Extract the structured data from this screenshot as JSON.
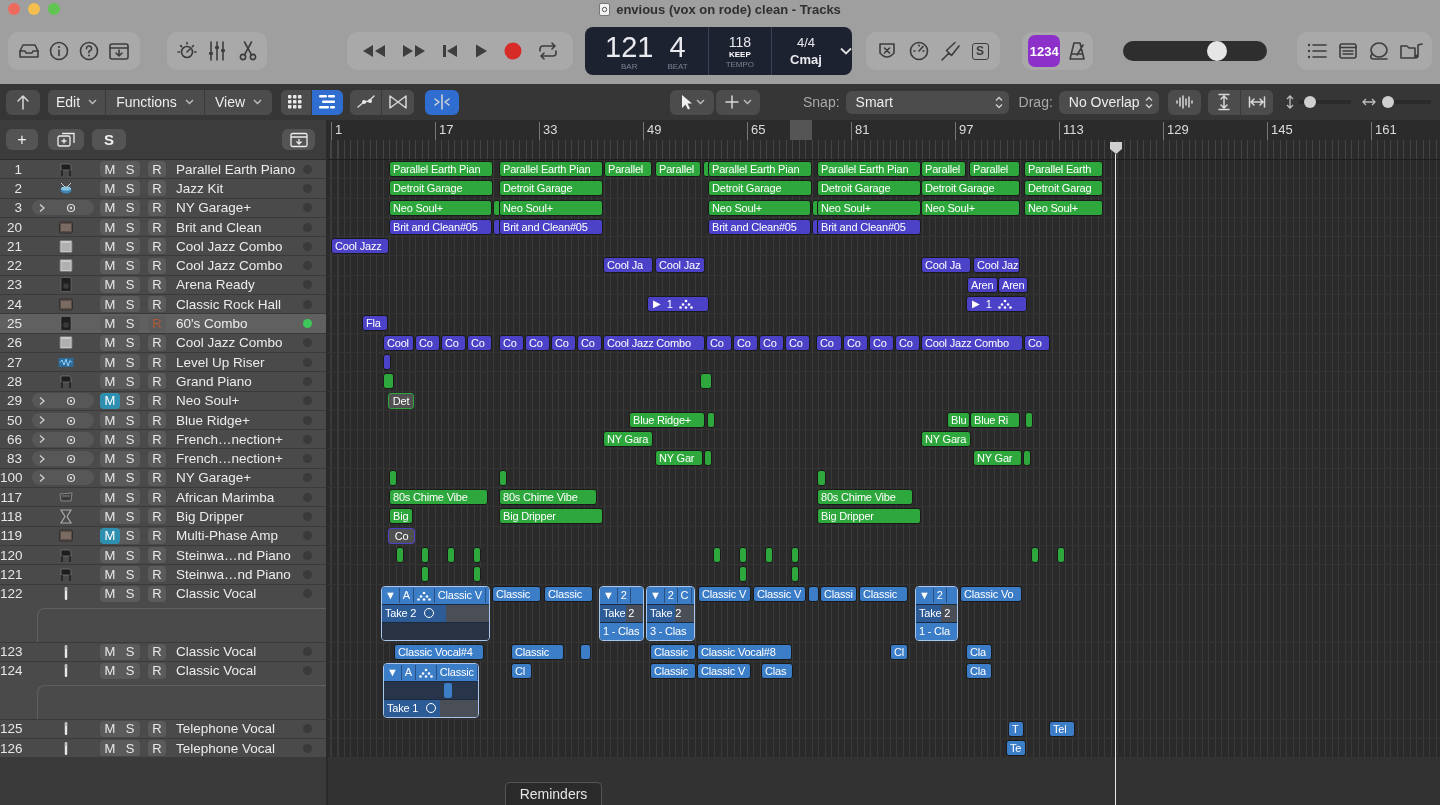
{
  "window": {
    "title": "envious (vox on rode) clean - Tracks"
  },
  "toolbar": {
    "letter_button": "S",
    "count_in": {
      "label": "1234",
      "on": true
    },
    "master_volume": {
      "level": 0.68
    }
  },
  "lcd": {
    "bar": "121",
    "bar_label": "BAR",
    "beat": "4",
    "beat_label": "BEAT",
    "tempo": "118",
    "tempo_mode": "KEEP",
    "tempo_label": "TEMPO",
    "signature": "4/4",
    "key": "Cmaj"
  },
  "control_bar": {
    "menus": [
      "Edit",
      "Functions",
      "View"
    ],
    "view_buttons": [
      {
        "kind": "grid",
        "selected": false
      },
      {
        "kind": "list",
        "selected": true
      }
    ],
    "mode_buttons": [
      {
        "kind": "automation",
        "selected": false
      },
      {
        "kind": "flex",
        "selected": false
      },
      {
        "kind": "catch",
        "selected": true
      }
    ],
    "snap": {
      "label": "Snap:",
      "value": "Smart"
    },
    "drag": {
      "label": "Drag:",
      "value": "No Overlap"
    },
    "zoom_sliders": [
      {
        "kind": "vertical",
        "level": 0.13
      },
      {
        "kind": "horizontal",
        "level": 0.03
      }
    ]
  },
  "track_header": {
    "add": "+",
    "solo_mode": "S"
  },
  "ruler": [
    "1",
    "17",
    "33",
    "49",
    "65",
    "81",
    "97",
    "113",
    "129",
    "145",
    "161"
  ],
  "tracks": [
    {
      "number": "1",
      "name": "Parallel Earth Piano",
      "kind": "piano",
      "stack": false,
      "takes_open": false,
      "muted": false,
      "selected": false,
      "buttons": [
        "M",
        "S",
        "R"
      ],
      "regions": [
        {
          "kind": "region",
          "label": "Parallel Earth Pian",
          "color": "#2ea83c"
        },
        {
          "kind": "region",
          "label": "Parallel Earth Pian",
          "color": "#2ea83c"
        },
        {
          "kind": "region",
          "label": "Parallel",
          "color": "#2ea83c"
        },
        {
          "kind": "region",
          "label": "Parallel",
          "color": "#2ea83c"
        },
        {
          "kind": "region",
          "color": "#2ea83c"
        },
        {
          "kind": "region",
          "label": "Parallel Earth Pian",
          "color": "#2ea83c"
        },
        {
          "kind": "region",
          "label": "Parallel Earth Pian",
          "color": "#2ea83c"
        },
        {
          "kind": "region",
          "label": "Parallel",
          "color": "#2ea83c"
        },
        {
          "kind": "region",
          "label": "Parallel",
          "color": "#2ea83c"
        },
        {
          "kind": "region",
          "label": "Parallel Earth",
          "color": "#2ea83c"
        }
      ]
    },
    {
      "number": "2",
      "name": "Jazz Kit",
      "kind": "drums",
      "stack": false,
      "takes_open": false,
      "muted": false,
      "selected": false,
      "buttons": [
        "M",
        "S",
        "R"
      ],
      "regions": [
        {
          "kind": "region",
          "label": "Detroit Garage",
          "color": "#2ea83c"
        },
        {
          "kind": "region",
          "label": "Detroit Garage",
          "color": "#2ea83c"
        },
        {
          "kind": "region",
          "label": "Detroit Garage",
          "color": "#2ea83c"
        },
        {
          "kind": "region",
          "label": "Detroit Garage",
          "color": "#2ea83c"
        },
        {
          "kind": "region",
          "label": "Detroit Garage",
          "color": "#2ea83c"
        },
        {
          "kind": "region",
          "label": "Detroit Garag",
          "color": "#2ea83c"
        }
      ]
    },
    {
      "number": "3",
      "name": "NY Garage+",
      "kind": "patch",
      "stack": true,
      "takes_open": false,
      "muted": false,
      "selected": false,
      "buttons": [
        "M",
        "S",
        "R"
      ],
      "regions": [
        {
          "kind": "region",
          "label": "Neo Soul+",
          "color": "#2ea83c"
        },
        {
          "kind": "region",
          "color": "#2ea83c"
        },
        {
          "kind": "region",
          "label": "Neo Soul+",
          "color": "#2ea83c"
        },
        {
          "kind": "region",
          "label": "Neo Soul+",
          "color": "#2ea83c"
        },
        {
          "kind": "region",
          "color": "#2ea83c"
        },
        {
          "kind": "region",
          "label": "Neo Soul+",
          "color": "#2ea83c"
        },
        {
          "kind": "region",
          "label": "Neo Soul+",
          "color": "#2ea83c"
        },
        {
          "kind": "region",
          "label": "Neo Soul+",
          "color": "#2ea83c"
        }
      ]
    },
    {
      "number": "20",
      "name": "Brit and Clean",
      "kind": "amp",
      "stack": false,
      "takes_open": false,
      "muted": false,
      "selected": false,
      "buttons": [
        "M",
        "S",
        "R"
      ],
      "regions": [
        {
          "kind": "region",
          "label": "Brit and Clean#05",
          "color": "#4c42c8"
        },
        {
          "kind": "region",
          "color": "#4c42c8"
        },
        {
          "kind": "region",
          "label": "Brit and Clean#05",
          "color": "#4c42c8"
        },
        {
          "kind": "region",
          "label": "Brit and Clean#05",
          "color": "#4c42c8"
        },
        {
          "kind": "region",
          "color": "#4c42c8"
        },
        {
          "kind": "region",
          "label": "Brit and Clean#05",
          "color": "#4c42c8"
        }
      ]
    },
    {
      "number": "21",
      "name": "Cool Jazz Combo",
      "kind": "cabinet",
      "stack": false,
      "takes_open": false,
      "muted": false,
      "selected": false,
      "buttons": [
        "M",
        "S",
        "R"
      ],
      "regions": [
        {
          "kind": "region",
          "label": "Cool Jazz",
          "color": "#4c42c8"
        }
      ]
    },
    {
      "number": "22",
      "name": "Cool Jazz Combo",
      "kind": "cabinet",
      "stack": false,
      "takes_open": false,
      "muted": false,
      "selected": false,
      "buttons": [
        "M",
        "S",
        "R"
      ],
      "regions": [
        {
          "kind": "region",
          "label": "Cool Ja",
          "color": "#4c42c8"
        },
        {
          "kind": "region",
          "label": "Cool Jaz",
          "color": "#4c42c8"
        },
        {
          "kind": "region",
          "label": "Cool Ja",
          "color": "#4c42c8"
        },
        {
          "kind": "region",
          "label": "Cool Jaz",
          "color": "#4c42c8"
        }
      ]
    },
    {
      "number": "23",
      "name": "Arena Ready",
      "kind": "tower",
      "stack": false,
      "takes_open": false,
      "muted": false,
      "selected": false,
      "buttons": [
        "M",
        "S",
        "R"
      ],
      "regions": [
        {
          "kind": "region",
          "label": "Aren",
          "color": "#4c42c8"
        },
        {
          "kind": "region",
          "label": "Aren",
          "color": "#4c42c8"
        }
      ]
    },
    {
      "number": "24",
      "name": "Classic Rock Hall",
      "kind": "amp",
      "stack": false,
      "takes_open": false,
      "muted": false,
      "selected": false,
      "buttons": [
        "M",
        "S",
        "R"
      ],
      "regions": [
        {
          "kind": "pattern",
          "play": "▶",
          "label": "1",
          "color": "#4c42c8"
        },
        {
          "kind": "pattern",
          "play": "▶",
          "label": "1",
          "color": "#4c42c8"
        }
      ]
    },
    {
      "number": "25",
      "name": "60's Combo",
      "kind": "tower",
      "stack": false,
      "takes_open": false,
      "muted": false,
      "selected": true,
      "buttons": [
        "M",
        "S",
        "R"
      ],
      "regions": [
        {
          "kind": "region",
          "label": "Fla",
          "color": "#4c42c8"
        }
      ]
    },
    {
      "number": "26",
      "name": "Cool Jazz Combo",
      "kind": "cabinet",
      "stack": false,
      "takes_open": false,
      "muted": false,
      "selected": false,
      "buttons": [
        "M",
        "S",
        "R"
      ],
      "regions": [
        {
          "kind": "region",
          "label": "Cool",
          "color": "#4c42c8"
        },
        {
          "kind": "region",
          "label": "Co",
          "color": "#4c42c8"
        },
        {
          "kind": "region",
          "label": "Co",
          "color": "#4c42c8"
        },
        {
          "kind": "region",
          "label": "Co",
          "color": "#4c42c8"
        },
        {
          "kind": "region",
          "label": "Co",
          "color": "#4c42c8"
        },
        {
          "kind": "region",
          "label": "Co",
          "color": "#4c42c8"
        },
        {
          "kind": "region",
          "label": "Co",
          "color": "#4c42c8"
        },
        {
          "kind": "region",
          "label": "Co",
          "color": "#4c42c8"
        },
        {
          "kind": "region",
          "label": "Cool Jazz Combo",
          "color": "#4c42c8"
        },
        {
          "kind": "region",
          "label": "Co",
          "color": "#4c42c8"
        },
        {
          "kind": "region",
          "label": "Co",
          "color": "#4c42c8"
        },
        {
          "kind": "region",
          "label": "Co",
          "color": "#4c42c8"
        },
        {
          "kind": "region",
          "label": "Co",
          "color": "#4c42c8"
        },
        {
          "kind": "region",
          "label": "Co",
          "color": "#4c42c8"
        },
        {
          "kind": "region",
          "label": "Co",
          "color": "#4c42c8"
        },
        {
          "kind": "region",
          "label": "Co",
          "color": "#4c42c8"
        },
        {
          "kind": "region",
          "label": "Co",
          "color": "#4c42c8"
        },
        {
          "kind": "region",
          "label": "Cool Jazz Combo",
          "color": "#4c42c8"
        },
        {
          "kind": "region",
          "label": "Co",
          "color": "#4c42c8"
        }
      ]
    },
    {
      "number": "27",
      "name": "Level Up Riser",
      "kind": "riser",
      "stack": false,
      "takes_open": false,
      "muted": false,
      "selected": false,
      "buttons": [
        "M",
        "S",
        "R"
      ],
      "regions": [
        {
          "kind": "region",
          "color": "#4c42c8"
        }
      ]
    },
    {
      "number": "28",
      "name": "Grand Piano",
      "kind": "piano",
      "stack": false,
      "takes_open": false,
      "muted": false,
      "selected": false,
      "buttons": [
        "M",
        "S",
        "R"
      ],
      "regions": [
        {
          "kind": "region",
          "color": "#2ea83c"
        },
        {
          "kind": "region",
          "color": "#2ea83c"
        }
      ]
    },
    {
      "number": "29",
      "name": "Neo Soul+",
      "kind": "patch",
      "stack": true,
      "takes_open": false,
      "muted": true,
      "selected": false,
      "buttons": [
        "M",
        "S",
        "R"
      ],
      "regions": [
        {
          "kind": "region",
          "label": "Det",
          "color": "#2ea83c"
        }
      ]
    },
    {
      "number": "50",
      "name": "Blue Ridge+",
      "kind": "patch",
      "stack": true,
      "takes_open": false,
      "muted": false,
      "selected": false,
      "buttons": [
        "M",
        "S",
        "R"
      ],
      "regions": [
        {
          "kind": "region",
          "label": "Blue Ridge+",
          "color": "#2ea83c"
        },
        {
          "kind": "region",
          "color": "#2ea83c"
        },
        {
          "kind": "region",
          "label": "Blu",
          "color": "#2ea83c"
        },
        {
          "kind": "region",
          "label": "Blue Ri",
          "color": "#2ea83c"
        },
        {
          "kind": "region",
          "color": "#2ea83c"
        }
      ]
    },
    {
      "number": "66",
      "name": "French…nection+",
      "kind": "patch",
      "stack": true,
      "takes_open": false,
      "muted": false,
      "selected": false,
      "buttons": [
        "M",
        "S",
        "R"
      ],
      "regions": [
        {
          "kind": "region",
          "label": "NY Gara",
          "color": "#2ea83c"
        },
        {
          "kind": "region",
          "label": "NY Gara",
          "color": "#2ea83c"
        }
      ]
    },
    {
      "number": "83",
      "name": "French…nection+",
      "kind": "patch",
      "stack": true,
      "takes_open": false,
      "muted": false,
      "selected": false,
      "buttons": [
        "M",
        "S",
        "R"
      ],
      "regions": [
        {
          "kind": "region",
          "label": "NY Gar",
          "color": "#2ea83c"
        },
        {
          "kind": "region",
          "color": "#2ea83c"
        },
        {
          "kind": "region",
          "label": "NY Gar",
          "color": "#2ea83c"
        },
        {
          "kind": "region",
          "color": "#2ea83c"
        }
      ]
    },
    {
      "number": "100",
      "name": "NY Garage+",
      "kind": "patch",
      "stack": true,
      "takes_open": false,
      "muted": false,
      "selected": false,
      "buttons": [
        "M",
        "S",
        "R"
      ],
      "regions": [
        {
          "kind": "region",
          "color": "#2ea83c"
        },
        {
          "kind": "region",
          "color": "#2ea83c"
        },
        {
          "kind": "region",
          "color": "#2ea83c"
        }
      ]
    },
    {
      "number": "117",
      "name": "African Marimba",
      "kind": "marimba",
      "stack": false,
      "takes_open": false,
      "muted": false,
      "selected": false,
      "buttons": [
        "M",
        "S",
        "R"
      ],
      "regions": [
        {
          "kind": "region",
          "label": "80s Chime Vibe",
          "color": "#2ea83c"
        },
        {
          "kind": "region",
          "label": "80s Chime Vibe",
          "color": "#2ea83c"
        },
        {
          "kind": "region",
          "label": "80s Chime Vibe",
          "color": "#2ea83c"
        }
      ]
    },
    {
      "number": "118",
      "name": "Big Dripper",
      "kind": "dripper",
      "stack": false,
      "takes_open": false,
      "muted": false,
      "selected": false,
      "buttons": [
        "M",
        "S",
        "R"
      ],
      "regions": [
        {
          "kind": "region",
          "label": "Big",
          "color": "#2ea83c"
        },
        {
          "kind": "region",
          "label": "Big Dripper",
          "color": "#2ea83c"
        },
        {
          "kind": "region",
          "label": "Big Dripper",
          "color": "#2ea83c"
        }
      ]
    },
    {
      "number": "119",
      "name": "Multi-Phase Amp",
      "kind": "amp",
      "stack": false,
      "takes_open": false,
      "muted": true,
      "selected": false,
      "buttons": [
        "M",
        "S",
        "R"
      ],
      "regions": [
        {
          "kind": "region",
          "label": "Co",
          "color": "#4c42c8"
        }
      ]
    },
    {
      "number": "120",
      "name": "Steinwa…nd Piano",
      "kind": "piano",
      "stack": false,
      "takes_open": false,
      "muted": false,
      "selected": false,
      "buttons": [
        "M",
        "S",
        "R"
      ],
      "regions": [
        {
          "kind": "region",
          "color": "#2ea83c"
        },
        {
          "kind": "region",
          "color": "#2ea83c"
        },
        {
          "kind": "region",
          "color": "#2ea83c"
        },
        {
          "kind": "region",
          "color": "#2ea83c"
        },
        {
          "kind": "region",
          "color": "#2ea83c"
        },
        {
          "kind": "region",
          "color": "#2ea83c"
        },
        {
          "kind": "region",
          "color": "#2ea83c"
        },
        {
          "kind": "region",
          "color": "#2ea83c"
        },
        {
          "kind": "region",
          "color": "#2ea83c"
        },
        {
          "kind": "region",
          "color": "#2ea83c"
        }
      ]
    },
    {
      "number": "121",
      "name": "Steinwa…nd Piano",
      "kind": "piano",
      "stack": false,
      "takes_open": false,
      "muted": false,
      "selected": false,
      "buttons": [
        "M",
        "S",
        "R"
      ],
      "regions": [
        {
          "kind": "region",
          "color": "#2ea83c"
        },
        {
          "kind": "region",
          "color": "#2ea83c"
        },
        {
          "kind": "region",
          "color": "#2ea83c"
        },
        {
          "kind": "region",
          "color": "#2ea83c"
        }
      ]
    },
    {
      "number": "122",
      "name": "Classic Vocal",
      "kind": "mic",
      "stack": false,
      "takes_open": true,
      "muted": false,
      "selected": false,
      "buttons": [
        "M",
        "S",
        "R"
      ],
      "regions": [
        {
          "kind": "take_folder",
          "color": "#3c7dc8",
          "header": [
            {
              "kind": "text",
              "text": "▼"
            },
            {
              "kind": "text",
              "text": "A"
            },
            {
              "kind": "icon"
            },
            {
              "kind": "text",
              "text": "Classic V"
            }
          ],
          "lanes": [
            {
              "kind": "take",
              "label": "Take 2",
              "circle": true
            },
            {
              "kind": "blank"
            }
          ]
        },
        {
          "kind": "region",
          "label": "Classic",
          "color": "#3c7dc8"
        },
        {
          "kind": "region",
          "label": "Classic",
          "color": "#3c7dc8"
        },
        {
          "kind": "take_folder",
          "color": "#3c7dc8",
          "header": [
            {
              "kind": "text",
              "text": "▼"
            },
            {
              "kind": "text",
              "text": "2"
            }
          ],
          "lanes": [
            {
              "kind": "take",
              "label": "Take 2",
              "circle": false
            },
            {
              "kind": "comp",
              "label": "1 - Clas"
            }
          ]
        },
        {
          "kind": "take_folder",
          "color": "#3c7dc8",
          "header": [
            {
              "kind": "text",
              "text": "▼"
            },
            {
              "kind": "text",
              "text": "2"
            },
            {
              "kind": "text",
              "text": "C"
            }
          ],
          "lanes": [
            {
              "kind": "take",
              "label": "Take 2",
              "circle": false
            },
            {
              "kind": "comp",
              "label": "3 - Clas"
            }
          ]
        },
        {
          "kind": "region",
          "label": "Classic V",
          "color": "#3c7dc8"
        },
        {
          "kind": "region",
          "label": "Classic V",
          "color": "#3c7dc8"
        },
        {
          "kind": "region",
          "color": "#3c7dc8"
        },
        {
          "kind": "region",
          "label": "Classi",
          "color": "#3c7dc8"
        },
        {
          "kind": "region",
          "label": "Classic",
          "color": "#3c7dc8"
        },
        {
          "kind": "take_folder",
          "color": "#3c7dc8",
          "header": [
            {
              "kind": "text",
              "text": "▼"
            },
            {
              "kind": "text",
              "text": "2"
            }
          ],
          "lanes": [
            {
              "kind": "take",
              "label": "Take 2",
              "circle": false
            },
            {
              "kind": "comp",
              "label": "1 - Cla"
            }
          ]
        },
        {
          "kind": "region",
          "label": "Classic Vo",
          "color": "#3c7dc8"
        }
      ]
    },
    {
      "number": "123",
      "name": "Classic Vocal",
      "kind": "mic",
      "stack": false,
      "takes_open": false,
      "muted": false,
      "selected": false,
      "buttons": [
        "M",
        "S",
        "R"
      ],
      "regions": [
        {
          "kind": "region",
          "label": "Classic Vocal#4",
          "color": "#3c7dc8"
        },
        {
          "kind": "region",
          "label": "Classic",
          "color": "#3c7dc8"
        },
        {
          "kind": "region",
          "color": "#3c7dc8"
        },
        {
          "kind": "region",
          "label": "Classic",
          "color": "#3c7dc8"
        },
        {
          "kind": "region",
          "label": "Classic Vocal#8",
          "color": "#3c7dc8"
        },
        {
          "kind": "region",
          "label": "Cl",
          "color": "#3c7dc8"
        },
        {
          "kind": "region",
          "label": "Cla",
          "color": "#3c7dc8"
        }
      ]
    },
    {
      "number": "124",
      "name": "Classic Vocal",
      "kind": "mic",
      "stack": false,
      "takes_open": true,
      "muted": false,
      "selected": false,
      "buttons": [
        "M",
        "S",
        "R"
      ],
      "regions": [
        {
          "kind": "take_folder",
          "color": "#3c7dc8",
          "header": [
            {
              "kind": "text",
              "text": "▼"
            },
            {
              "kind": "text",
              "text": "A"
            },
            {
              "kind": "icon"
            },
            {
              "kind": "text",
              "text": "Classic"
            }
          ],
          "lanes": [
            {
              "kind": "clip"
            },
            {
              "kind": "take",
              "label": "Take 1",
              "circle": true
            }
          ]
        },
        {
          "kind": "region",
          "label": "Cl",
          "color": "#3c7dc8"
        },
        {
          "kind": "region",
          "label": "Classic",
          "color": "#3c7dc8"
        },
        {
          "kind": "region",
          "label": "Classic V",
          "color": "#3c7dc8"
        },
        {
          "kind": "region",
          "label": "Clas",
          "color": "#3c7dc8"
        },
        {
          "kind": "region",
          "label": "Cla",
          "color": "#3c7dc8"
        }
      ]
    },
    {
      "number": "125",
      "name": "Telephone Vocal",
      "kind": "mic",
      "stack": false,
      "takes_open": false,
      "muted": false,
      "selected": false,
      "buttons": [
        "M",
        "S",
        "R"
      ],
      "regions": [
        {
          "kind": "region",
          "label": "T",
          "color": "#3c7dc8"
        },
        {
          "kind": "region",
          "label": "Tel",
          "color": "#3c7dc8"
        }
      ]
    },
    {
      "number": "126",
      "name": "Telephone Vocal",
      "kind": "mic",
      "stack": false,
      "takes_open": false,
      "muted": false,
      "selected": false,
      "buttons": [
        "M",
        "S",
        "R"
      ],
      "regions": [
        {
          "kind": "region",
          "label": "Te",
          "color": "#3c7dc8"
        }
      ]
    }
  ],
  "footer": {
    "tab": "Reminders"
  }
}
